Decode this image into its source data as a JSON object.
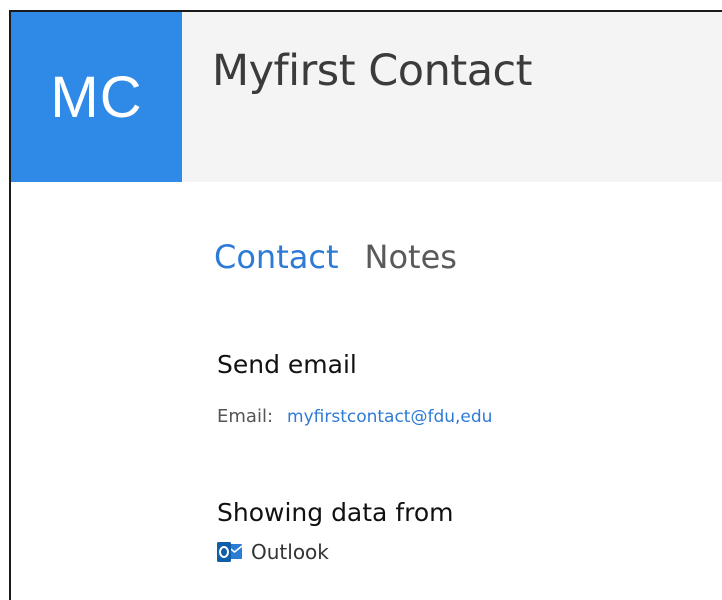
{
  "header": {
    "avatar_initials": "MC",
    "avatar_color": "#2e8ae6",
    "contact_name": "Myfirst Contact"
  },
  "tabs": [
    {
      "label": "Contact",
      "active": true
    },
    {
      "label": "Notes",
      "active": false
    }
  ],
  "send_email": {
    "title": "Send email",
    "email_label": "Email:",
    "email_value": "myfirstcontact@fdu,edu"
  },
  "showing_data": {
    "title": "Showing data from",
    "source_icon": "outlook-icon",
    "source_label": "Outlook"
  },
  "colors": {
    "accent": "#2e7bd6",
    "header_bg": "#f4f4f4"
  }
}
